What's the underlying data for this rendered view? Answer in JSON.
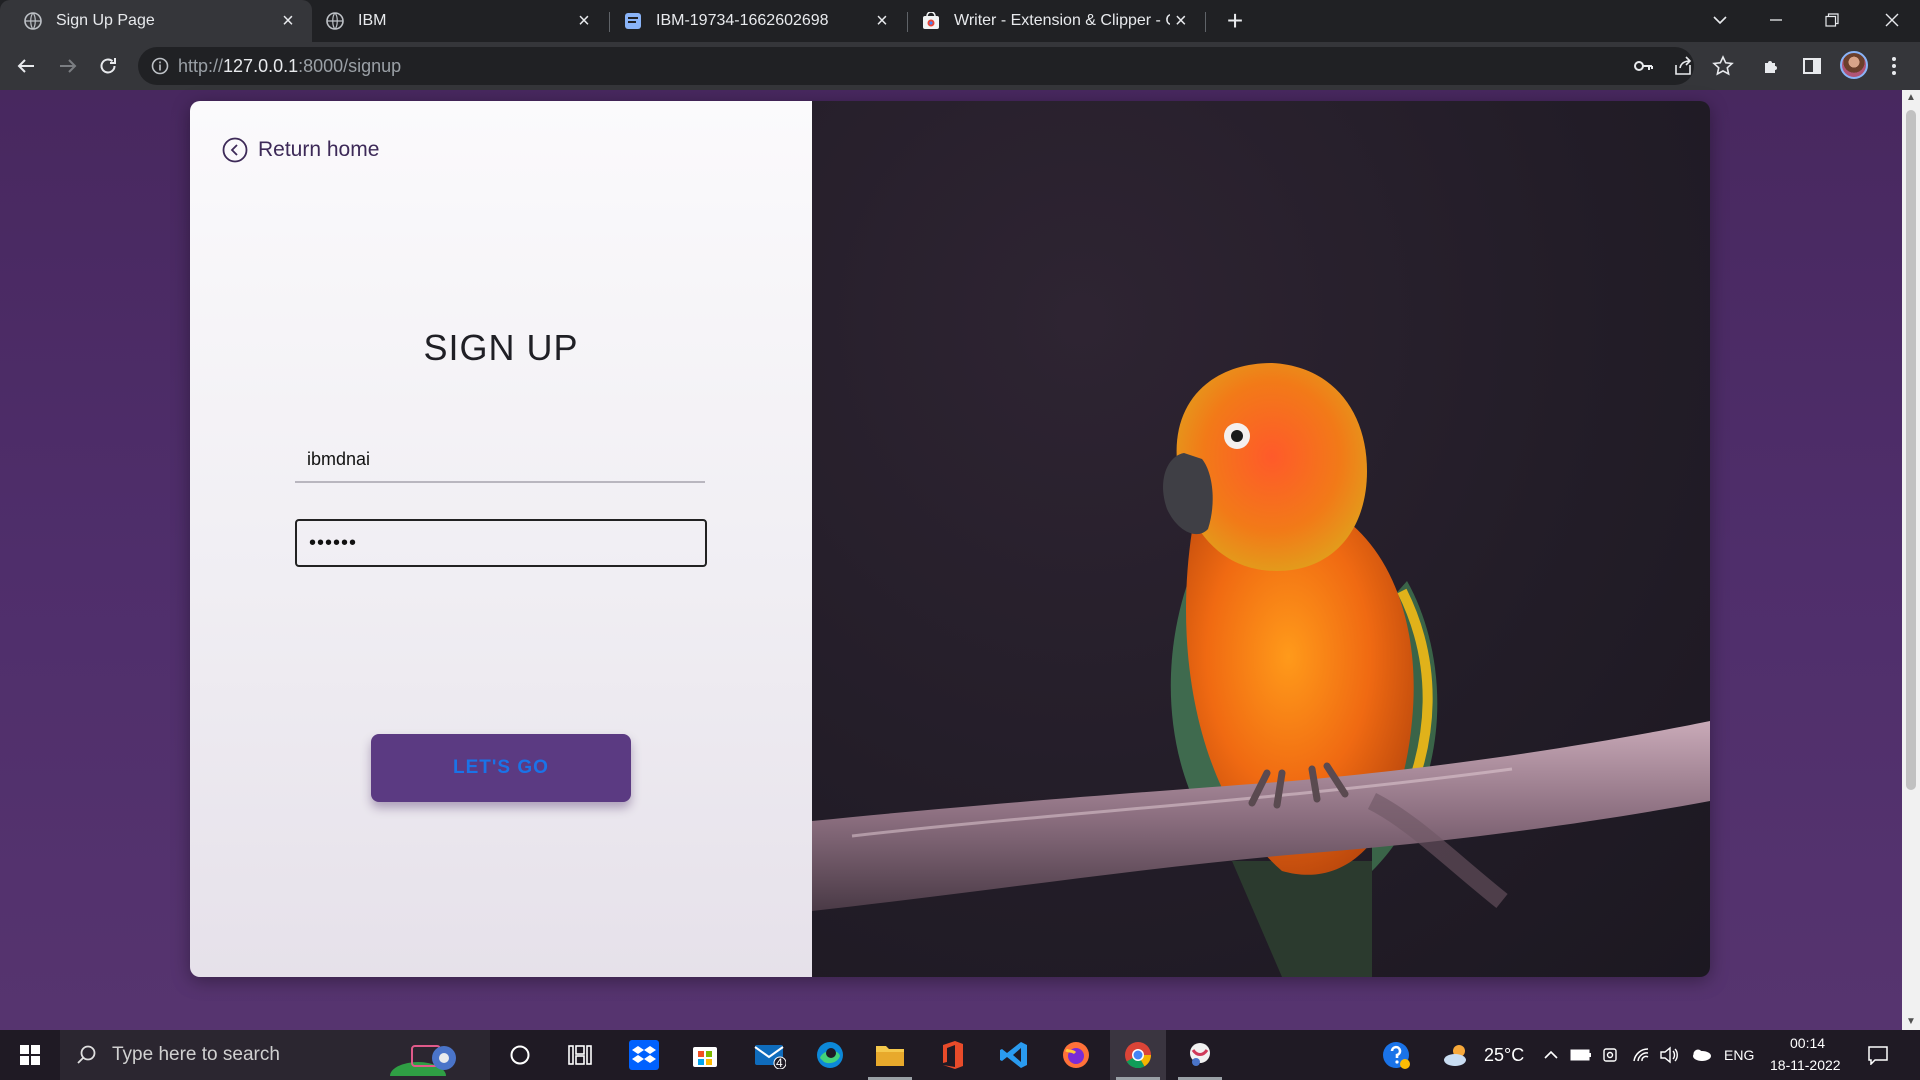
{
  "browser": {
    "tabs": [
      {
        "title": "Sign Up Page",
        "active": true
      },
      {
        "title": "IBM",
        "active": false
      },
      {
        "title": "IBM-19734-1662602698",
        "active": false
      },
      {
        "title": "Writer - Extension & Clipper - Ch",
        "active": false
      }
    ],
    "url_scheme": "http://",
    "url_host": "127.0.0.1",
    "url_path": ":8000/signup"
  },
  "page": {
    "return_home": "Return home",
    "title": "SIGN UP",
    "username_value": "ibmdnai",
    "password_value": "••••••",
    "submit_label": "LET'S GO"
  },
  "taskbar": {
    "search_placeholder": "Type here to search",
    "mail_badge": "4",
    "temperature": "25°C",
    "language": "ENG",
    "time": "00:14",
    "date": "18-11-2022"
  },
  "colors": {
    "page_background": "#4d2d68",
    "button_background": "#5b3a82",
    "button_text": "#1a73e8"
  }
}
